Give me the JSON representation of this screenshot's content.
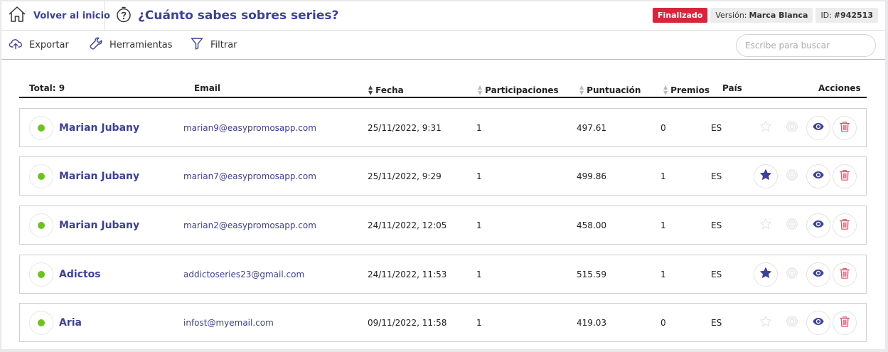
{
  "header": {
    "home_label": "Volver al inicio",
    "title": "¿Cuánto sabes sobres series?",
    "status_badge": "Finalizado",
    "version_label": "Versión:",
    "version_value": "Marca Blanca",
    "id_label": "ID:",
    "id_value": "#942513"
  },
  "toolbar": {
    "export_label": "Exportar",
    "tools_label": "Herramientas",
    "filter_label": "Filtrar",
    "search_placeholder": "Escribe para buscar",
    "search_value": ""
  },
  "table": {
    "columns": {
      "total": "Total: 9",
      "email": "Email",
      "date": "Fecha",
      "participations": "Participaciones",
      "score": "Puntuación",
      "prizes": "Premios",
      "country": "País",
      "actions": "Acciones"
    },
    "sorted_column": "Fecha",
    "rows": [
      {
        "name": "Marian Jubany",
        "email": "marian9@easypromosapp.com",
        "date": "25/11/2022, 9:31",
        "participations": "1",
        "score": "497.61",
        "prizes": "0",
        "country": "ES",
        "starred": false
      },
      {
        "name": "Marian Jubany",
        "email": "marian7@easypromosapp.com",
        "date": "25/11/2022, 9:29",
        "participations": "1",
        "score": "499.86",
        "prizes": "1",
        "country": "ES",
        "starred": true
      },
      {
        "name": "Marian Jubany",
        "email": "marian2@easypromosapp.com",
        "date": "24/11/2022, 12:05",
        "participations": "1",
        "score": "458.00",
        "prizes": "1",
        "country": "ES",
        "starred": false
      },
      {
        "name": "Adictos",
        "email": "addictoseries23@gmail.com",
        "date": "24/11/2022, 11:53",
        "participations": "1",
        "score": "515.59",
        "prizes": "1",
        "country": "ES",
        "starred": true
      },
      {
        "name": "Aria",
        "email": "infost@myemail.com",
        "date": "09/11/2022, 11:58",
        "participations": "1",
        "score": "419.03",
        "prizes": "0",
        "country": "ES",
        "starred": false
      }
    ]
  },
  "colors": {
    "accent": "#3b3f9e",
    "status_red": "#d9253c",
    "active_dot": "#6cc31c",
    "delete": "#d9536a"
  },
  "icons": {
    "home": "home-icon",
    "timer": "stopwatch-icon",
    "export": "cloud-upload-icon",
    "tools": "wrench-icon",
    "filter": "filter-icon",
    "star": "star-icon",
    "target": "target-icon",
    "view": "eye-icon",
    "delete": "trash-icon"
  }
}
